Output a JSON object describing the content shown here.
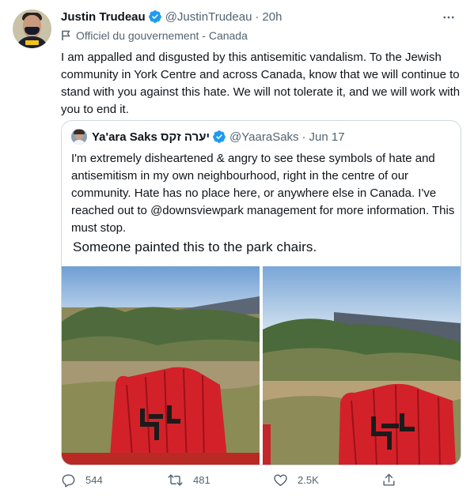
{
  "author": {
    "name": "Justin Trudeau",
    "handle": "@JustinTrudeau",
    "time": "20h",
    "label": "Officiel du gouvernement - Canada"
  },
  "tweet": {
    "text": "I am appalled and disgusted by this antisemitic vandalism. To the Jewish community in York Centre and across Canada, know that we will continue to stand with you against this hate. We will not tolerate it, and we will work with you to end it."
  },
  "quoted": {
    "name": "Ya'ara Saks יערה זקס",
    "handle": "@YaaraSaks",
    "date": "Jun 17",
    "text": "I'm extremely disheartened & angry to see these symbols of hate and antisemitism in my own neighbourhood, right in the centre of our community. Hate has no place here, or anywhere else in Canada. I've reached out to @downsviewpark management for more information. This must stop.",
    "caption": "Someone painted this to the park chairs."
  },
  "actions": {
    "replies": "544",
    "retweets": "481",
    "likes": "2.5K"
  },
  "icons": {
    "verified": "verified-badge-icon",
    "more": "more-options-icon",
    "gov_label": "flag-icon",
    "reply": "reply-icon",
    "retweet": "retweet-icon",
    "like": "heart-icon",
    "share": "share-icon"
  },
  "colors": {
    "verified": "#1d9bf0",
    "secondary_text": "#536471",
    "chair_red": "#d3212a"
  }
}
